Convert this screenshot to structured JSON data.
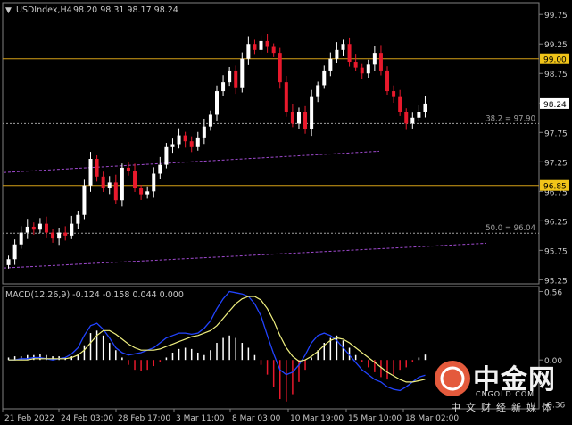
{
  "chart_data": {
    "type": "candlestick",
    "header": {
      "arrow": "▼",
      "symbol": "USDIndex,H4",
      "ohlc": "98.20 98.31 98.17 98.24"
    },
    "y_ticks": [
      "99.75",
      "99.25",
      "98.75",
      "98.25",
      "97.75",
      "97.25",
      "96.75",
      "96.25",
      "95.75",
      "95.25"
    ],
    "y_range": [
      95.18,
      99.95
    ],
    "x_labels": [
      "21 Feb 2022",
      "24 Feb 03:00",
      "28 Feb 17:00",
      "3 Mar 11:00",
      "8 Mar 03:00",
      "10 Mar 19:00",
      "15 Mar 10:00",
      "18 Mar 02:00"
    ],
    "last_price": "98.24",
    "levels": [
      {
        "value": 99.0,
        "label": "99.00",
        "color": "#d4a017"
      },
      {
        "value": 96.85,
        "label": "96.85",
        "color": "#d4a017"
      }
    ],
    "fib_levels": [
      {
        "value": 97.9,
        "label": "38.2 = 97.90"
      },
      {
        "value": 96.04,
        "label": "50.0 = 96.04"
      }
    ],
    "candles": [
      95.6,
      95.85,
      96.05,
      96.15,
      96.1,
      96.2,
      96.05,
      95.95,
      96.05,
      96.0,
      96.2,
      96.35,
      96.85,
      97.3,
      97.0,
      96.8,
      96.9,
      96.6,
      97.15,
      97.1,
      96.8,
      96.7,
      96.75,
      97.05,
      97.2,
      97.5,
      97.55,
      97.7,
      97.6,
      97.5,
      97.65,
      97.85,
      98.05,
      98.45,
      98.6,
      98.8,
      98.5,
      99.0,
      99.25,
      99.15,
      99.3,
      99.2,
      99.1,
      98.6,
      98.1,
      97.9,
      98.1,
      97.8,
      98.35,
      98.55,
      98.8,
      99.0,
      99.15,
      99.25,
      98.95,
      98.85,
      98.75,
      98.9,
      99.1,
      98.8,
      98.45,
      98.35,
      98.1,
      97.9,
      98.0,
      98.1,
      98.24
    ],
    "trendlines": [
      {
        "from": [
          97.07
        ],
        "to": [
          97.43
        ],
        "style": "dashed",
        "color": "#a04ad0"
      },
      {
        "from": [
          95.45
        ],
        "to": [
          95.87
        ],
        "style": "dashed",
        "color": "#a04ad0"
      }
    ],
    "macd": {
      "label": "MACD(12,26,9) -0.124 -0.158 0.044 0.000",
      "y_ticks": [
        "0.56",
        "0.00",
        "-0.36"
      ],
      "y_range": [
        -0.4,
        0.6
      ],
      "histogram": [
        0.02,
        0.03,
        0.03,
        0.04,
        0.04,
        0.05,
        0.04,
        0.03,
        0.03,
        0.02,
        0.03,
        0.05,
        0.12,
        0.22,
        0.24,
        0.2,
        0.14,
        0.08,
        0.02,
        -0.04,
        -0.08,
        -0.09,
        -0.08,
        -0.05,
        -0.02,
        0.02,
        0.06,
        0.09,
        0.1,
        0.09,
        0.06,
        0.04,
        0.08,
        0.14,
        0.18,
        0.2,
        0.18,
        0.14,
        0.1,
        0.04,
        -0.04,
        -0.12,
        -0.22,
        -0.32,
        -0.34,
        -0.28,
        -0.18,
        -0.08,
        0.02,
        0.08,
        0.14,
        0.18,
        0.2,
        0.16,
        0.1,
        0.04,
        -0.02,
        -0.06,
        -0.1,
        -0.14,
        -0.16,
        -0.12,
        -0.08,
        -0.06,
        -0.02,
        0.02,
        0.044
      ],
      "macd_line": [
        0.0,
        0.0,
        0.01,
        0.01,
        0.02,
        0.02,
        0.01,
        0.0,
        0.01,
        0.02,
        0.05,
        0.1,
        0.2,
        0.28,
        0.3,
        0.25,
        0.18,
        0.1,
        0.06,
        0.04,
        0.05,
        0.06,
        0.08,
        0.1,
        0.14,
        0.18,
        0.2,
        0.22,
        0.22,
        0.21,
        0.22,
        0.26,
        0.32,
        0.42,
        0.5,
        0.56,
        0.55,
        0.54,
        0.52,
        0.46,
        0.36,
        0.2,
        0.05,
        -0.08,
        -0.12,
        -0.1,
        -0.04,
        0.04,
        0.14,
        0.2,
        0.22,
        0.2,
        0.16,
        0.1,
        0.04,
        -0.02,
        -0.08,
        -0.12,
        -0.16,
        -0.18,
        -0.22,
        -0.24,
        -0.25,
        -0.22,
        -0.18,
        -0.14,
        -0.124
      ],
      "signal_line": [
        0.0,
        0.0,
        0.0,
        0.0,
        0.01,
        0.01,
        0.01,
        0.01,
        0.01,
        0.01,
        0.02,
        0.04,
        0.08,
        0.14,
        0.2,
        0.24,
        0.24,
        0.21,
        0.17,
        0.13,
        0.1,
        0.08,
        0.08,
        0.08,
        0.09,
        0.11,
        0.13,
        0.15,
        0.17,
        0.19,
        0.2,
        0.22,
        0.24,
        0.28,
        0.34,
        0.4,
        0.46,
        0.5,
        0.52,
        0.52,
        0.49,
        0.42,
        0.32,
        0.2,
        0.1,
        0.03,
        -0.01,
        0.0,
        0.03,
        0.07,
        0.12,
        0.16,
        0.18,
        0.17,
        0.14,
        0.1,
        0.06,
        0.02,
        -0.02,
        -0.06,
        -0.1,
        -0.13,
        -0.16,
        -0.18,
        -0.18,
        -0.17,
        -0.158
      ]
    }
  },
  "watermark": {
    "cn": "中金网",
    "url": "CNGOLD.COM",
    "sub": "中文财经新媒体",
    "logo_color": "#e45a3c"
  }
}
